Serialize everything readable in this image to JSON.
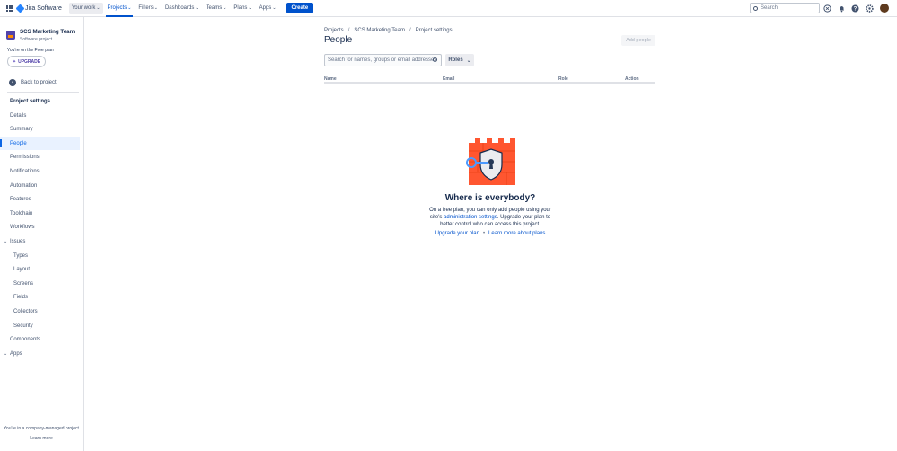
{
  "topbar": {
    "product": "Jira Software",
    "nav": [
      {
        "label": "Your work",
        "highlight": true,
        "active": false
      },
      {
        "label": "Projects",
        "highlight": false,
        "active": true
      },
      {
        "label": "Filters",
        "highlight": false,
        "active": false
      },
      {
        "label": "Dashboards",
        "highlight": false,
        "active": false
      },
      {
        "label": "Teams",
        "highlight": false,
        "active": false
      },
      {
        "label": "Plans",
        "highlight": false,
        "active": false
      },
      {
        "label": "Apps",
        "highlight": false,
        "active": false
      }
    ],
    "create_label": "Create",
    "search_placeholder": "Search",
    "icons": [
      "notifications-icon",
      "bell-icon",
      "help-icon",
      "settings-icon"
    ]
  },
  "sidebar": {
    "project_name": "SCS Marketing Team",
    "project_type": "Software project",
    "plan_note": "You're on the Free plan",
    "upgrade_label": "UPGRADE",
    "back_label": "Back to project",
    "settings_title": "Project settings",
    "items": [
      {
        "label": "Details",
        "indent": false,
        "active": false,
        "expander": false
      },
      {
        "label": "Summary",
        "indent": false,
        "active": false,
        "expander": false
      },
      {
        "label": "People",
        "indent": false,
        "active": true,
        "expander": false
      },
      {
        "label": "Permissions",
        "indent": false,
        "active": false,
        "expander": false
      },
      {
        "label": "Notifications",
        "indent": false,
        "active": false,
        "expander": false
      },
      {
        "label": "Automation",
        "indent": false,
        "active": false,
        "expander": false
      },
      {
        "label": "Features",
        "indent": false,
        "active": false,
        "expander": false
      },
      {
        "label": "Toolchain",
        "indent": false,
        "active": false,
        "expander": false
      },
      {
        "label": "Workflows",
        "indent": false,
        "active": false,
        "expander": false
      },
      {
        "label": "Issues",
        "indent": false,
        "active": false,
        "expander": true
      },
      {
        "label": "Types",
        "indent": true,
        "active": false,
        "expander": false
      },
      {
        "label": "Layout",
        "indent": true,
        "active": false,
        "expander": false
      },
      {
        "label": "Screens",
        "indent": true,
        "active": false,
        "expander": false
      },
      {
        "label": "Fields",
        "indent": true,
        "active": false,
        "expander": false
      },
      {
        "label": "Collectors",
        "indent": true,
        "active": false,
        "expander": false
      },
      {
        "label": "Security",
        "indent": true,
        "active": false,
        "expander": false
      },
      {
        "label": "Components",
        "indent": false,
        "active": false,
        "expander": false
      },
      {
        "label": "Apps",
        "indent": false,
        "active": false,
        "expander": true
      }
    ],
    "footer_note": "You're in a company-managed project",
    "footer_link": "Learn more"
  },
  "main": {
    "breadcrumbs": [
      "Projects",
      "SCS Marketing Team",
      "Project settings"
    ],
    "title": "People",
    "add_people_label": "Add people",
    "search_placeholder": "Search for names, groups or email addresses",
    "roles_label": "Roles",
    "columns": [
      "Name",
      "Email",
      "Role",
      "Action"
    ],
    "empty": {
      "title": "Where is everybody?",
      "desc_before": "On a free plan, you can only add people using your site's ",
      "desc_link": "administration settings",
      "desc_after": ". Upgrade your plan to better control who can access this project.",
      "link_upgrade": "Upgrade your plan",
      "link_separator": "•",
      "link_learn": "Learn more about plans"
    }
  },
  "colors": {
    "brand": "#0052cc",
    "castle": "#ff5630",
    "selection": "#e9f2ff"
  }
}
